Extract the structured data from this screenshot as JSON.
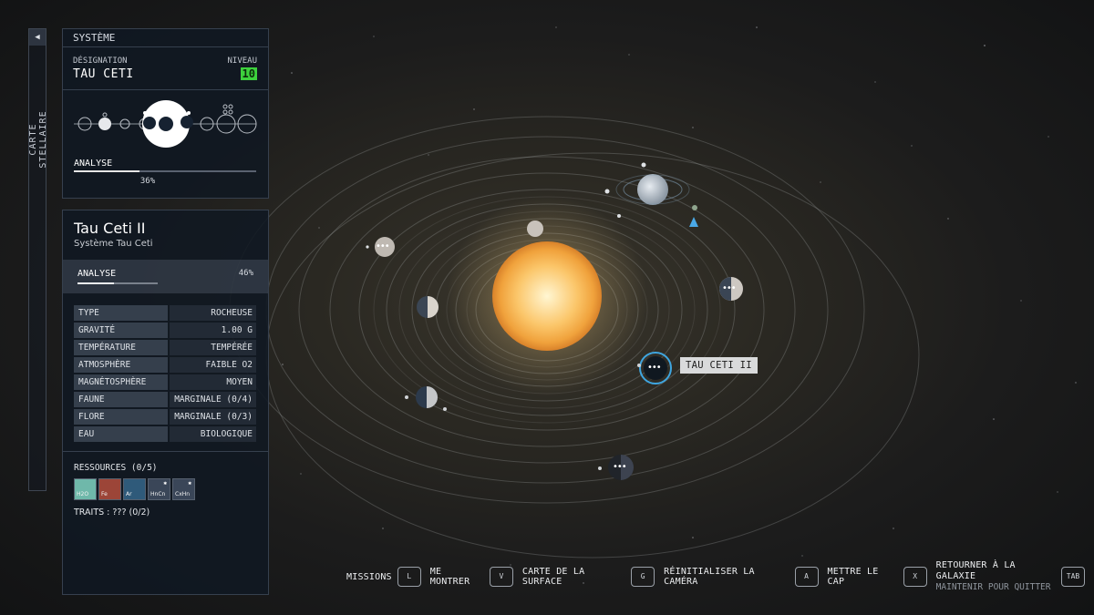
{
  "side_tab": {
    "label": "CARTE STELLAIRE",
    "collapse_icon": "◀"
  },
  "system_panel": {
    "header": "SYSTÈME",
    "designation_label": "DÉSIGNATION",
    "designation_value": "TAU CETI",
    "level_label": "NIVEAU",
    "level_value": "10",
    "analysis_label": "ANALYSE",
    "analysis_percent": "36%",
    "analysis_fraction": 0.36
  },
  "planet_panel": {
    "name": "Tau Ceti II",
    "subtitle": "Système Tau Ceti",
    "scan_label": "ANALYSE",
    "scan_percent": "46%",
    "scan_fraction": 0.46,
    "attributes": [
      {
        "key": "TYPE",
        "value": "ROCHEUSE"
      },
      {
        "key": "GRAVITÉ",
        "value": "1.00 G"
      },
      {
        "key": "TEMPÉRATURE",
        "value": "TEMPÉRÉE"
      },
      {
        "key": "ATMOSPHÈRE",
        "value": "FAIBLE O2"
      },
      {
        "key": "MAGNÉTOSPHÈRE",
        "value": "MOYEN"
      },
      {
        "key": "FAUNE",
        "value": "MARGINALE (0/4)"
      },
      {
        "key": "FLORE",
        "value": "MARGINALE (0/3)"
      },
      {
        "key": "EAU",
        "value": "BIOLOGIQUE"
      }
    ],
    "resources_label": "RESSOURCES  (0/5)",
    "resources": [
      {
        "code": "H2O",
        "color": "#6fb8aa",
        "marked": false
      },
      {
        "code": "Fe",
        "color": "#9c4538",
        "marked": false
      },
      {
        "code": "Ar",
        "color": "#2f5a7a",
        "marked": false
      },
      {
        "code": "HnCn",
        "color": "#3a4658",
        "marked": true
      },
      {
        "code": "CxHn",
        "color": "#3a4658",
        "marked": true
      }
    ],
    "traits": "TRAITS : ??? (0/2)"
  },
  "tooltip": "TAU CETI II",
  "planet_marker": "•••",
  "hints": [
    {
      "label": "MISSIONS",
      "key": "L"
    },
    {
      "label": "ME MONTRER",
      "key": "V"
    },
    {
      "label": "CARTE DE LA SURFACE",
      "key": "G"
    },
    {
      "label": "RÉINITIALISER LA CAMÉRA",
      "key": "A"
    },
    {
      "label": "METTRE LE CAP",
      "key": "X"
    }
  ],
  "hint_last": {
    "label": "RETOURNER À LA GALAXIE",
    "sub": "MAINTENIR POUR QUITTER",
    "key": "TAB"
  }
}
